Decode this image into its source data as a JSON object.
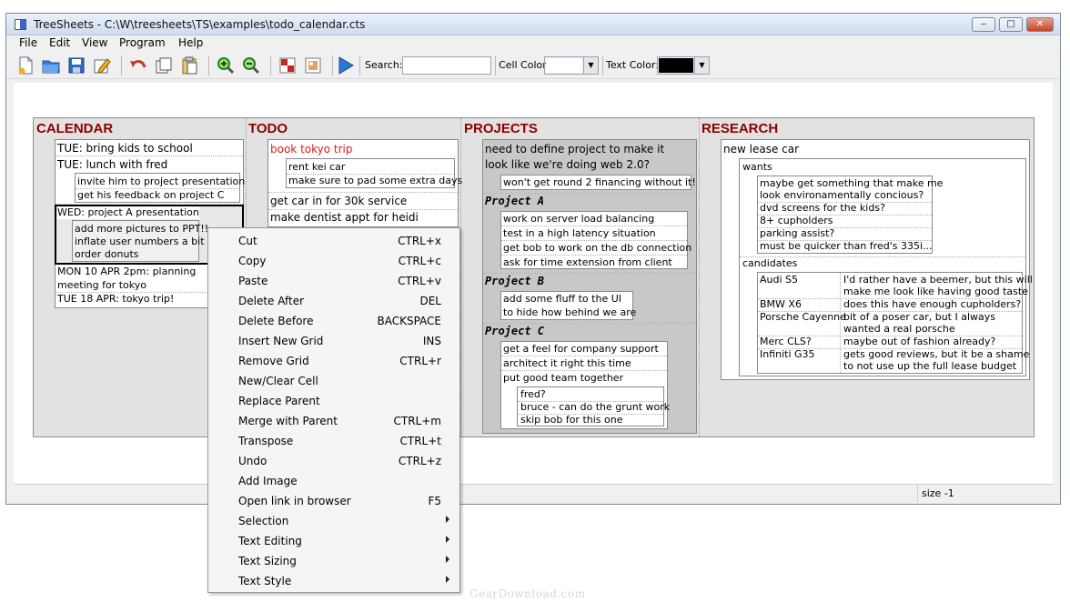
{
  "window": {
    "title": "TreeSheets - C:\\W\\treesheets\\TS\\examples\\todo_calendar.cts",
    "minimize_glyph": "‒",
    "maximize_glyph": "□",
    "close_glyph": "✕"
  },
  "menu": [
    "File",
    "Edit",
    "View",
    "Program",
    "Help"
  ],
  "toolbar": {
    "icons": [
      "new-file-icon",
      "open-folder-icon",
      "save-icon",
      "edit-icon",
      "undo-icon",
      "copy-icon",
      "paste-icon",
      "zoom-in-icon",
      "zoom-out-icon",
      "delete-cell-icon",
      "image-icon",
      "run-icon"
    ],
    "search_label": "Search:",
    "search_value": "",
    "cell_color_label": "Cell Color:",
    "cell_color": "#ffffff",
    "text_color_label": "Text Color:",
    "text_color": "#000000",
    "dropdown_glyph": "▼"
  },
  "sheet": {
    "headings": [
      "CALENDAR",
      "TODO",
      "PROJECTS",
      "RESEARCH"
    ],
    "calendar": {
      "items": [
        "TUE: bring kids to school",
        "TUE: lunch with fred"
      ],
      "fred_sub": [
        "invite him to project presentation",
        "get his feedback on project C"
      ],
      "wed": "WED: project A presentation",
      "wed_sub": [
        "add more pictures to PPT!!",
        "inflate user numbers a bit",
        "order donuts"
      ],
      "mon": [
        "MON 10 APR 2pm: planning",
        "meeting for tokyo"
      ],
      "tue18": "TUE 18 APR: tokyo trip!"
    },
    "todo": {
      "tokyo": "book tokyo trip",
      "tokyo_sub": [
        "rent kei car",
        "make sure to pad some extra days"
      ],
      "items": [
        "get car in for 30k service",
        "make dentist appt for heidi"
      ]
    },
    "projects": {
      "intro": [
        "need to define project to make it",
        "look like we're doing web 2.0?"
      ],
      "intro_sub": "won't get round 2 financing without it!",
      "a_title": "Project A",
      "a_items": [
        "work on server load balancing",
        "test in a high latency situation",
        "get bob to work on the db connection",
        "ask for time extension from client"
      ],
      "b_title": "Project B",
      "b_items": [
        "add some fluff to the UI",
        "to hide how behind we are"
      ],
      "c_title": "Project C",
      "c_items": [
        "get a feel for company support",
        "architect it right this time",
        "put good team together"
      ],
      "c_sub": [
        "fred?",
        "bruce - can do the grunt work",
        "skip bob for this one"
      ]
    },
    "research": {
      "title": "new lease car",
      "wants_label": "wants",
      "wants": [
        "maybe get something that make me",
        "look environamentally concious?",
        "dvd screens for the kids?",
        "8+ cupholders",
        "parking assist?",
        "must be quicker than fred's 335i..."
      ],
      "candidates_label": "candidates",
      "candidates": [
        {
          "car": "Audi S5",
          "notes": [
            "I'd rather have a beemer, but this will",
            "make me look like having good taste"
          ]
        },
        {
          "car": "BMW X6",
          "notes": [
            "does this have enough cupholders?"
          ]
        },
        {
          "car": "Porsche Cayenne",
          "notes": [
            "bit of a poser car, but I always",
            "wanted a real porsche"
          ]
        },
        {
          "car": "Merc CLS?",
          "notes": [
            "maybe out of fashion already?"
          ]
        },
        {
          "car": "Infiniti G35",
          "notes": [
            "gets good reviews, but it be a shame",
            "to not use up the full lease budget"
          ]
        }
      ]
    }
  },
  "status": {
    "size": "size -1"
  },
  "context_menu": [
    {
      "label": "Cut",
      "shortcut": "CTRL+x"
    },
    {
      "label": "Copy",
      "shortcut": "CTRL+c"
    },
    {
      "label": "Paste",
      "shortcut": "CTRL+v"
    },
    {
      "label": "Delete After",
      "shortcut": "DEL"
    },
    {
      "label": "Delete Before",
      "shortcut": "BACKSPACE"
    },
    {
      "label": "Insert New Grid",
      "shortcut": "INS"
    },
    {
      "label": "Remove Grid",
      "shortcut": "CTRL+r"
    },
    {
      "label": "New/Clear Cell",
      "shortcut": ""
    },
    {
      "label": "Replace Parent",
      "shortcut": ""
    },
    {
      "label": "Merge with Parent",
      "shortcut": "CTRL+m"
    },
    {
      "label": "Transpose",
      "shortcut": "CTRL+t"
    },
    {
      "label": "Undo",
      "shortcut": "CTRL+z"
    },
    {
      "label": "Add Image",
      "shortcut": ""
    },
    {
      "label": "Open link in browser",
      "shortcut": "F5"
    },
    {
      "label": "Selection",
      "shortcut": "",
      "submenu": true
    },
    {
      "label": "Text Editing",
      "shortcut": "",
      "submenu": true
    },
    {
      "label": "Text Sizing",
      "shortcut": "",
      "submenu": true
    },
    {
      "label": "Text Style",
      "shortcut": "",
      "submenu": true
    }
  ],
  "watermark": "GearDownload.com"
}
